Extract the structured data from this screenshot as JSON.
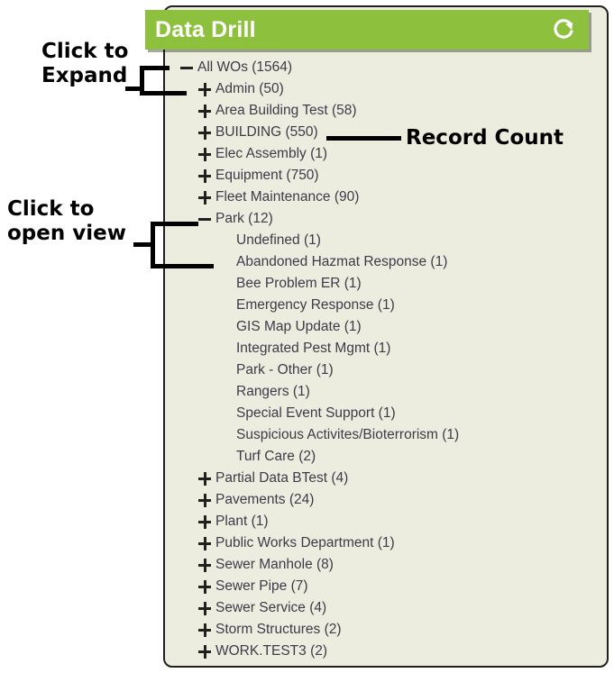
{
  "panel": {
    "title": "Data Drill",
    "refresh_icon": "refresh-icon",
    "colors": {
      "header_green": "#8dc03c",
      "panel_background": "#ecedde",
      "border": "#231f20",
      "label_text": "#3e3a4a",
      "title_text": "#ffffff",
      "annotation_text": "#000000"
    }
  },
  "annotations": [
    {
      "id": "click-to-expand",
      "line1": "Click to",
      "line2": "Expand"
    },
    {
      "id": "click-to-open-view",
      "line1": "Click to",
      "line2": "open view"
    },
    {
      "id": "record-count",
      "line1": "Record Count"
    }
  ],
  "tree": {
    "items": [
      {
        "label": "All WOs (1564)",
        "toggle": "minus",
        "level": 0
      },
      {
        "label": "Admin (50)",
        "toggle": "plus",
        "level": 1
      },
      {
        "label": "Area Building Test (58)",
        "toggle": "plus",
        "level": 1
      },
      {
        "label": "BUILDING (550)",
        "toggle": "plus",
        "level": 1
      },
      {
        "label": "Elec Assembly (1)",
        "toggle": "plus",
        "level": 1
      },
      {
        "label": "Equipment (750)",
        "toggle": "plus",
        "level": 1
      },
      {
        "label": "Fleet Maintenance (90)",
        "toggle": "plus",
        "level": 1
      },
      {
        "label": "Park (12)",
        "toggle": "minus",
        "level": 1
      },
      {
        "label": "Undefined (1)",
        "toggle": "none",
        "level": 2
      },
      {
        "label": "Abandoned Hazmat Response (1)",
        "toggle": "none",
        "level": 2
      },
      {
        "label": "Bee Problem ER (1)",
        "toggle": "none",
        "level": 2
      },
      {
        "label": "Emergency Response (1)",
        "toggle": "none",
        "level": 2
      },
      {
        "label": "GIS Map Update (1)",
        "toggle": "none",
        "level": 2
      },
      {
        "label": "Integrated Pest Mgmt (1)",
        "toggle": "none",
        "level": 2
      },
      {
        "label": "Park - Other (1)",
        "toggle": "none",
        "level": 2
      },
      {
        "label": "Rangers (1)",
        "toggle": "none",
        "level": 2
      },
      {
        "label": "Special Event Support (1)",
        "toggle": "none",
        "level": 2
      },
      {
        "label": "Suspicious Activites/Bioterrorism (1)",
        "toggle": "none",
        "level": 2
      },
      {
        "label": "Turf Care (2)",
        "toggle": "none",
        "level": 2
      },
      {
        "label": "Partial Data BTest (4)",
        "toggle": "plus",
        "level": 1
      },
      {
        "label": "Pavements (24)",
        "toggle": "plus",
        "level": 1
      },
      {
        "label": "Plant (1)",
        "toggle": "plus",
        "level": 1
      },
      {
        "label": "Public Works Department (1)",
        "toggle": "plus",
        "level": 1
      },
      {
        "label": "Sewer Manhole (8)",
        "toggle": "plus",
        "level": 1
      },
      {
        "label": "Sewer Pipe (7)",
        "toggle": "plus",
        "level": 1
      },
      {
        "label": "Sewer Service (4)",
        "toggle": "plus",
        "level": 1
      },
      {
        "label": "Storm Structures (2)",
        "toggle": "plus",
        "level": 1
      },
      {
        "label": "WORK.TEST3 (2)",
        "toggle": "plus",
        "level": 1
      }
    ]
  }
}
